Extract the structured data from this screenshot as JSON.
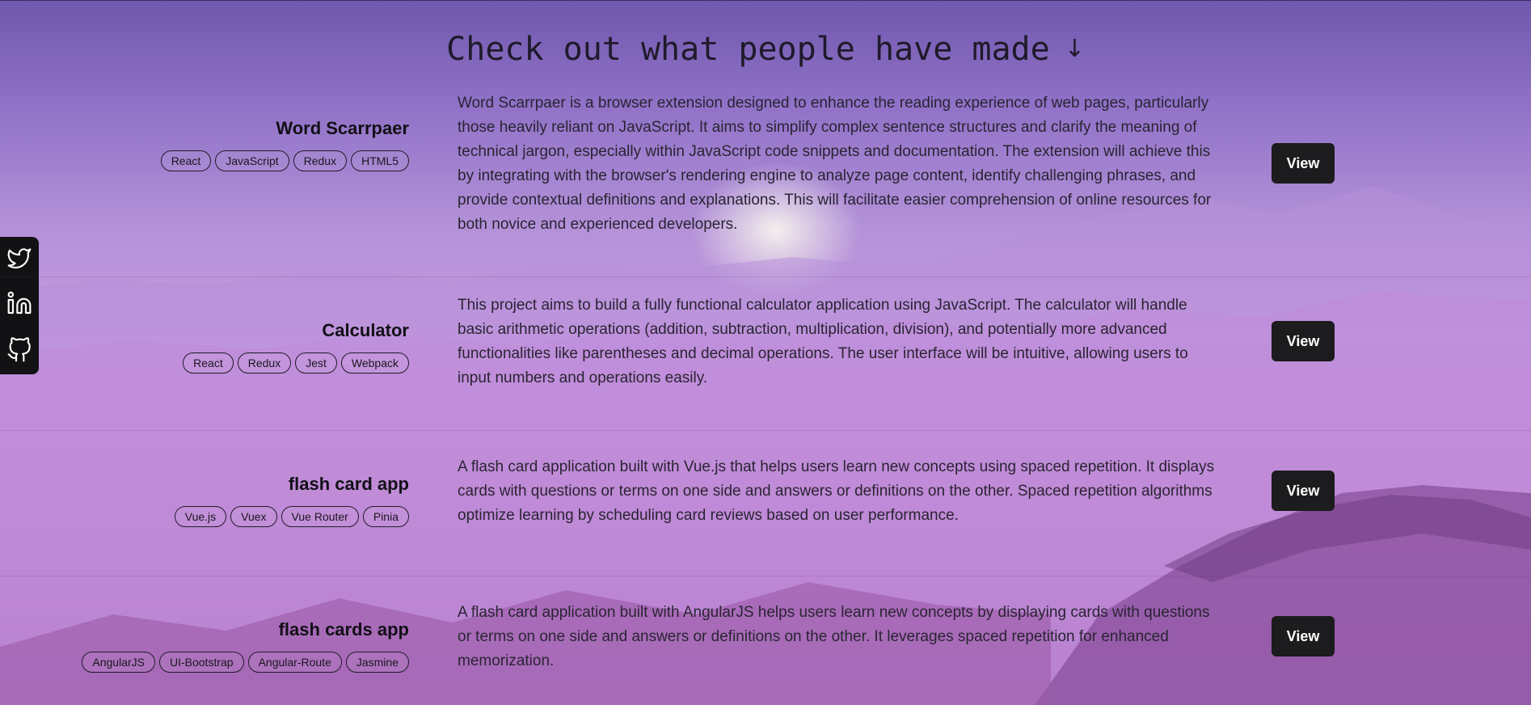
{
  "heading": {
    "text": "Check out what people have made",
    "arrow_glyph": "↓"
  },
  "colors": {
    "button_bg": "#1c1b1d",
    "button_text": "#ffffff",
    "heading_text": "#1f1a2a",
    "social_bar_bg": "#121113"
  },
  "social": [
    {
      "icon": "twitter-icon"
    },
    {
      "icon": "linkedin-icon"
    },
    {
      "icon": "github-icon"
    }
  ],
  "projects": [
    {
      "title": "Word Scarrpaer",
      "tags": [
        "React",
        "JavaScript",
        "Redux",
        "HTML5"
      ],
      "description": "Word Scarrpaer is a browser extension designed to enhance the reading experience of web pages, particularly those heavily reliant on JavaScript. It aims to simplify complex sentence structures and clarify the meaning of technical jargon, especially within JavaScript code snippets and documentation. The extension will achieve this by integrating with the browser's rendering engine to analyze page content, identify challenging phrases, and provide contextual definitions and explanations. This will facilitate easier comprehension of online resources for both novice and experienced developers.",
      "button_label": "View"
    },
    {
      "title": "Calculator",
      "tags": [
        "React",
        "Redux",
        "Jest",
        "Webpack"
      ],
      "description": "This project aims to build a fully functional calculator application using JavaScript. The calculator will handle basic arithmetic operations (addition, subtraction, multiplication, division), and potentially more advanced functionalities like parentheses and decimal operations. The user interface will be intuitive, allowing users to input numbers and operations easily.",
      "button_label": "View"
    },
    {
      "title": "flash card app",
      "tags": [
        "Vue.js",
        "Vuex",
        "Vue Router",
        "Pinia"
      ],
      "description": "A flash card application built with Vue.js that helps users learn new concepts using spaced repetition. It displays cards with questions or terms on one side and answers or definitions on the other. Spaced repetition algorithms optimize learning by scheduling card reviews based on user performance.",
      "button_label": "View"
    },
    {
      "title": "flash cards app",
      "tags": [
        "AngularJS",
        "UI-Bootstrap",
        "Angular-Route",
        "Jasmine"
      ],
      "description": "A flash card application built with AngularJS helps users learn new concepts by displaying cards with questions or terms on one side and answers or definitions on the other. It leverages spaced repetition for enhanced memorization.",
      "button_label": "View"
    }
  ]
}
